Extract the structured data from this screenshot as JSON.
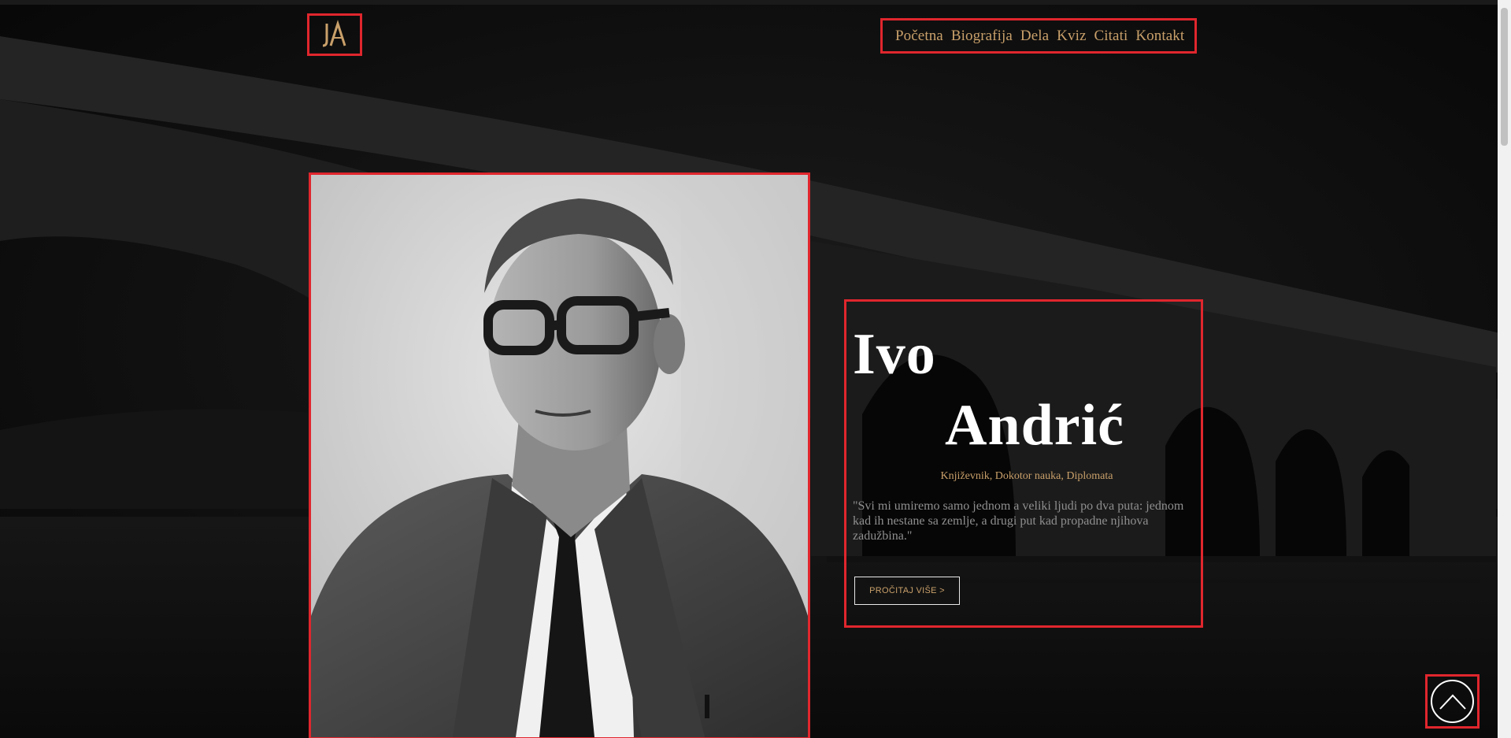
{
  "logo": {
    "monogram": "IA",
    "icon": "ia-monogram-logo"
  },
  "nav": {
    "items": [
      {
        "label": "Početna"
      },
      {
        "label": "Biografija"
      },
      {
        "label": "Dela"
      },
      {
        "label": "Kviz"
      },
      {
        "label": "Citati"
      },
      {
        "label": "Kontakt"
      }
    ]
  },
  "hero": {
    "first_name": "Ivo",
    "last_name": "Andrić",
    "roles": "Književnik, Dokotor nauka, Diplomata",
    "quote": "\"Svi mi umiremo samo jednom a veliki ljudi po dva puta: jednom kad ih nestane sa zemlje, a drugi put kad propadne njihova zadužbina.\"",
    "button_label": "PROČITAJ VIŠE >"
  },
  "portrait": {
    "icon": "author-portrait-image"
  },
  "back_to_top": {
    "icon": "chevron-up-icon"
  },
  "colors": {
    "accent_gold": "#c9a06a",
    "highlight_red": "#e0262d",
    "background": "#0b0b0b"
  }
}
